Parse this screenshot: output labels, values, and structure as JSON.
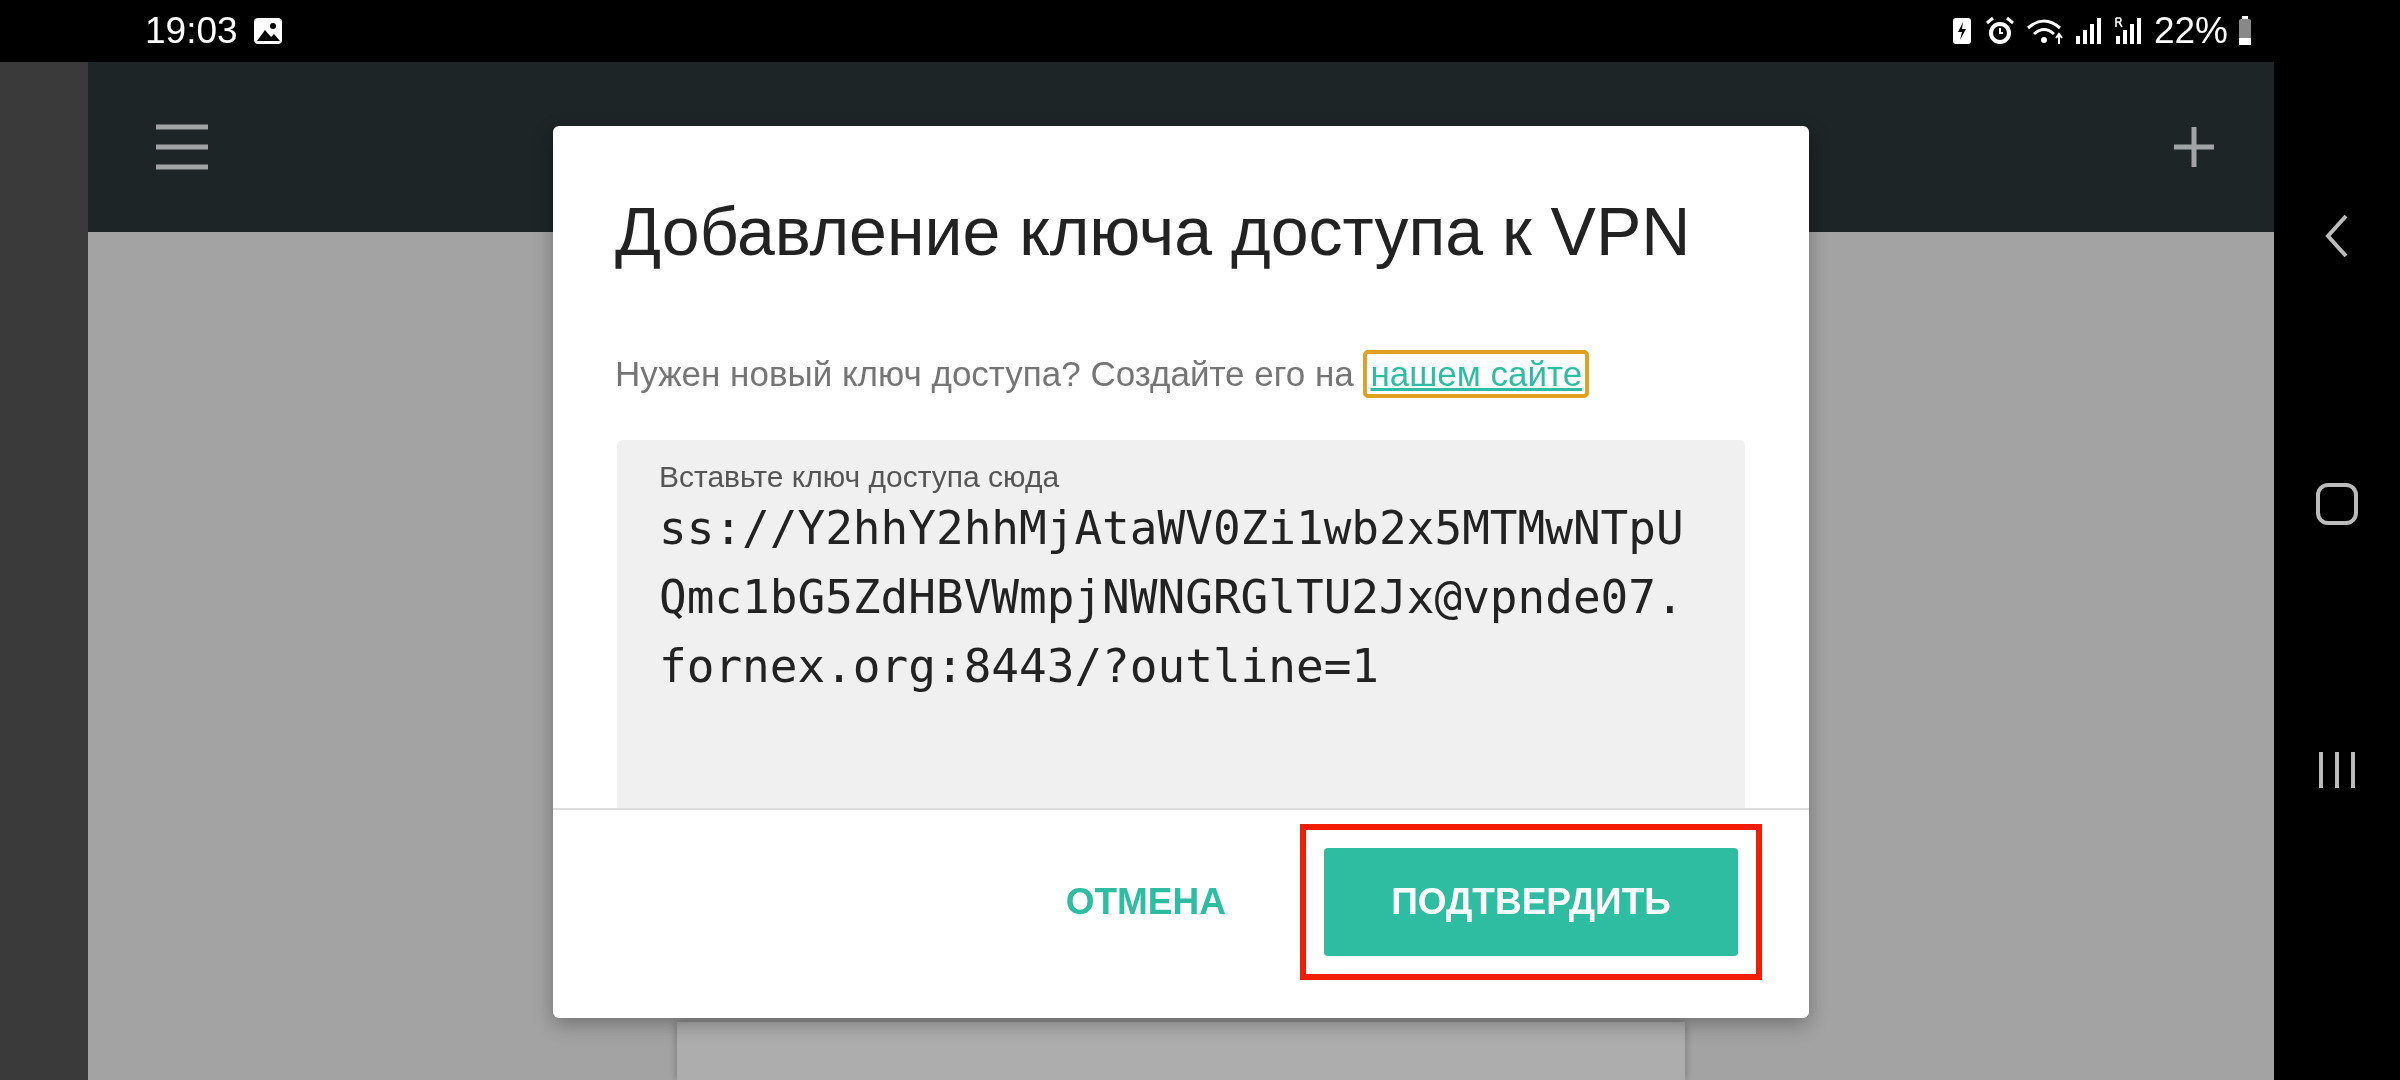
{
  "status_bar": {
    "time": "19:03",
    "battery": "22%"
  },
  "dialog": {
    "title": "Добавление ключа доступа к VPN",
    "prompt": "Нужен новый ключ доступа? Создайте его на",
    "link": {
      "label": "нашем сайте",
      "focused": true
    },
    "field": {
      "label": "Вставьте ключ доступа сюда",
      "value": "ss://Y2hhY2hhMjAtaWV0Zi1wb2x5MTMwNTpUQmc1bG5ZdHBVWmpjNWNGRGlTU2Jx@vpnde07.fornex.org:8443/?outline=1"
    },
    "buttons": [
      {
        "label": "ОТМЕНА",
        "kind": "text",
        "highlighted": false
      },
      {
        "label": "ПОДТВЕРДИТЬ",
        "kind": "filled",
        "highlighted": true
      }
    ]
  }
}
